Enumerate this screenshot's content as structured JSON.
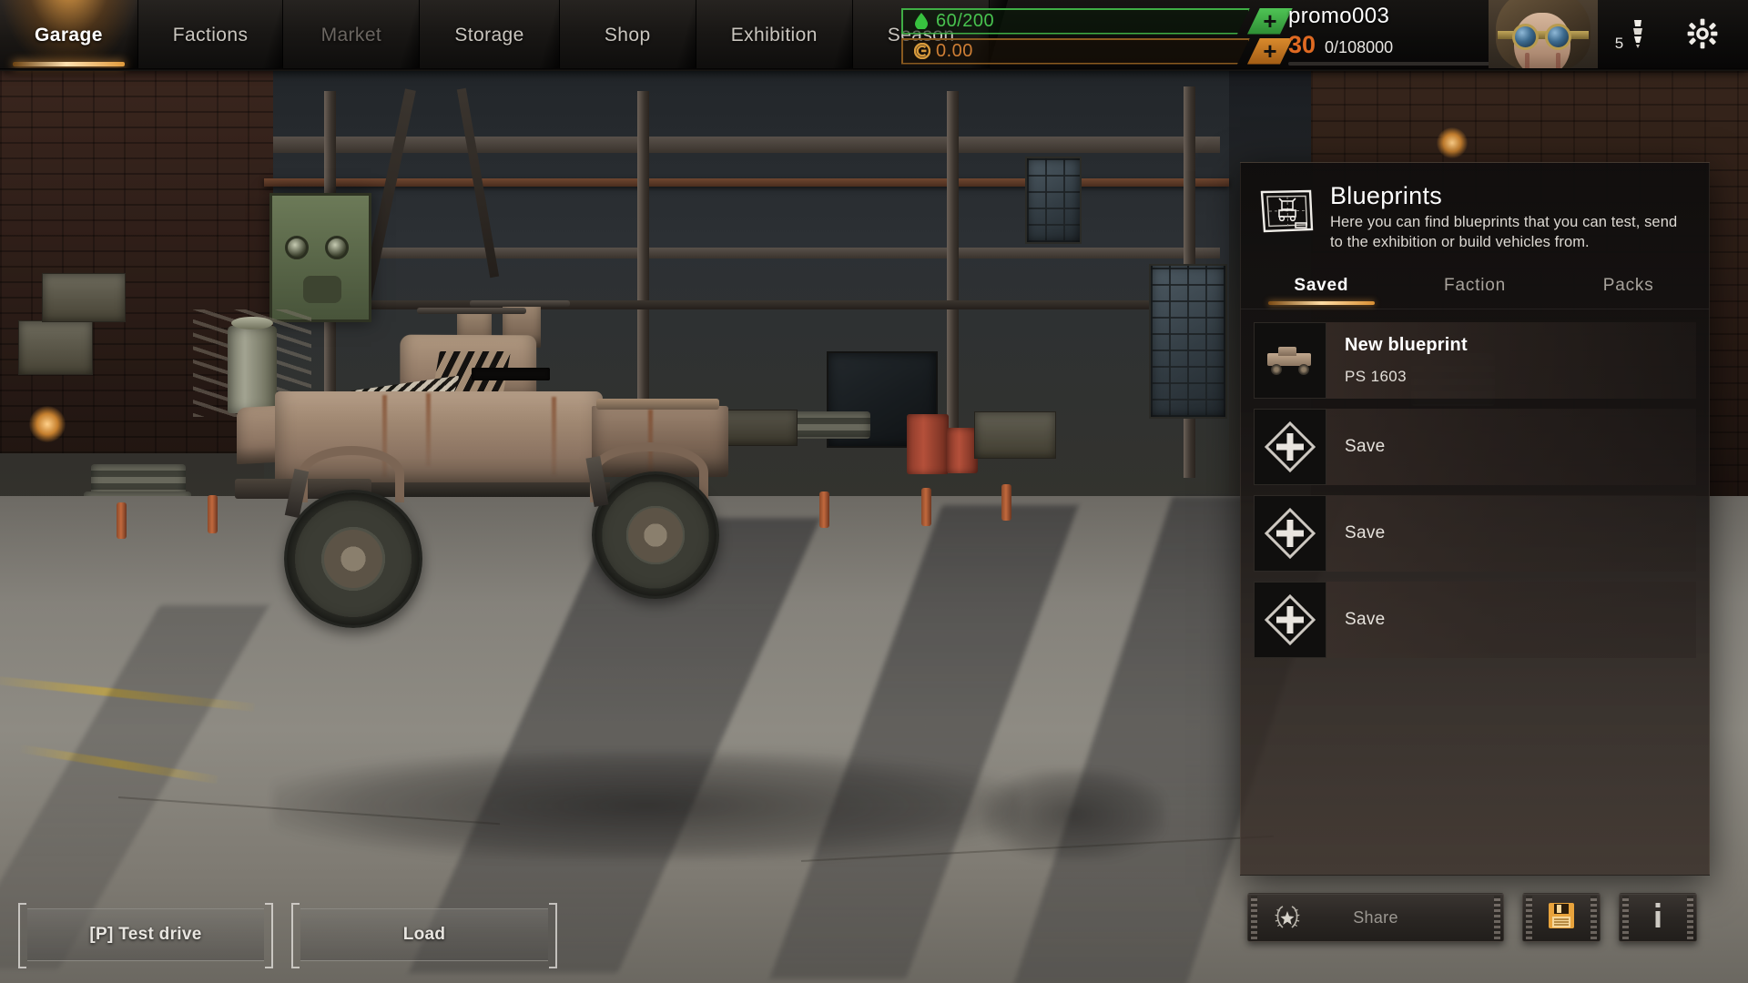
{
  "nav": {
    "tabs": [
      {
        "label": "Garage",
        "state": "active"
      },
      {
        "label": "Factions",
        "state": "normal"
      },
      {
        "label": "Market",
        "state": "disabled"
      },
      {
        "label": "Storage",
        "state": "normal"
      },
      {
        "label": "Shop",
        "state": "normal"
      },
      {
        "label": "Exhibition",
        "state": "normal"
      },
      {
        "label": "Season",
        "state": "normal"
      }
    ]
  },
  "resources": {
    "fuel": {
      "icon": "fuel-drop-icon",
      "value": "60/200",
      "plus_label": "+",
      "color": "#48c34f"
    },
    "coin": {
      "icon": "coin-icon",
      "value": "0.00",
      "plus_label": "+",
      "color": "#cf7f35"
    }
  },
  "player": {
    "name": "promo003",
    "level": "30",
    "xp": "0/108000",
    "xp_percent": 0,
    "avatar": "player-avatar",
    "bomb": {
      "icon": "bomb-icon",
      "count": "5"
    },
    "settings_icon": "gear-icon"
  },
  "blueprints": {
    "icon": "blueprint-sheet-icon",
    "title": "Blueprints",
    "description": "Here you can find blueprints that you can test, send to the exhibition or build vehicles from.",
    "tabs": [
      {
        "label": "Saved",
        "active": true
      },
      {
        "label": "Faction",
        "active": false
      },
      {
        "label": "Packs",
        "active": false
      }
    ],
    "rows": [
      {
        "type": "blueprint",
        "name": "New blueprint",
        "ps": "PS 1603",
        "thumb": "vehicle-thumbnail"
      },
      {
        "type": "empty",
        "label": "Save",
        "thumb": "diamond-plus-icon"
      },
      {
        "type": "empty",
        "label": "Save",
        "thumb": "diamond-plus-icon"
      },
      {
        "type": "empty",
        "label": "Save",
        "thumb": "diamond-plus-icon"
      }
    ]
  },
  "actions": {
    "test_drive": "[P] Test drive",
    "load": "Load",
    "share": "Share",
    "share_icon": "laurel-star-icon",
    "save_icon": "floppy-save-icon",
    "info_icon": "info-icon"
  },
  "colors": {
    "accent": "#e09a3c",
    "fuel_green": "#48c34f",
    "coin_orange": "#cf7f35",
    "level_orange": "#e06a22",
    "panel_bg": "#16110f"
  }
}
